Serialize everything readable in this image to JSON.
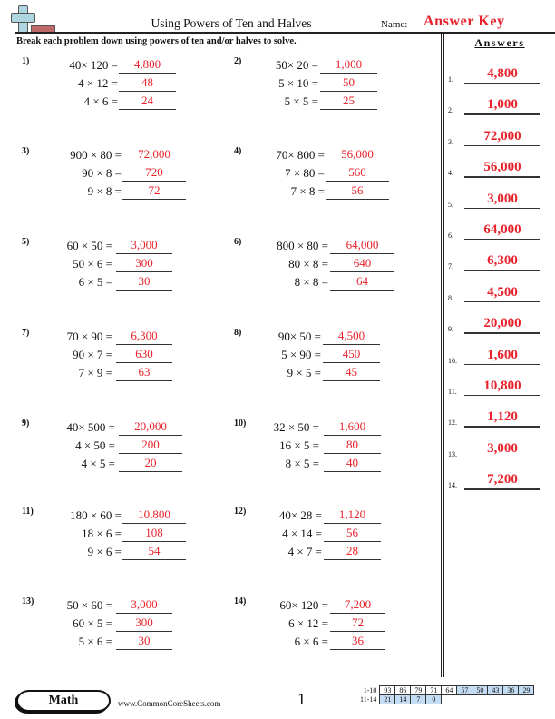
{
  "header": {
    "title": "Using Powers of Ten and Halves",
    "name_label": "Name:",
    "name_value": "Answer Key",
    "instructions": "Break each problem down using powers of ten and/or halves to solve.",
    "logo_icon": "plus-sign-with-bar-icon"
  },
  "accent_color": "#e8222b",
  "problems": [
    {
      "num": "1)",
      "rows": [
        {
          "expr": "40× 120 =",
          "ans": "4,800"
        },
        {
          "expr": "4 × 12 =",
          "ans": "48"
        },
        {
          "expr": "4 × 6 =",
          "ans": "24"
        }
      ]
    },
    {
      "num": "2)",
      "rows": [
        {
          "expr": "50× 20 =",
          "ans": "1,000"
        },
        {
          "expr": "5 × 10 =",
          "ans": "50"
        },
        {
          "expr": "5 × 5 =",
          "ans": "25"
        }
      ]
    },
    {
      "num": "3)",
      "rows": [
        {
          "expr": "900 × 80 =",
          "ans": "72,000"
        },
        {
          "expr": "90 × 8 =",
          "ans": "720"
        },
        {
          "expr": "9 × 8 =",
          "ans": "72"
        }
      ]
    },
    {
      "num": "4)",
      "rows": [
        {
          "expr": "70× 800 =",
          "ans": "56,000"
        },
        {
          "expr": "7 × 80 =",
          "ans": "560"
        },
        {
          "expr": "7 × 8 =",
          "ans": "56"
        }
      ]
    },
    {
      "num": "5)",
      "rows": [
        {
          "expr": "60 × 50 =",
          "ans": "3,000"
        },
        {
          "expr": "50 × 6 =",
          "ans": "300"
        },
        {
          "expr": "6 × 5 =",
          "ans": "30"
        }
      ]
    },
    {
      "num": "6)",
      "rows": [
        {
          "expr": "800 × 80 =",
          "ans": "64,000"
        },
        {
          "expr": "80 × 8 =",
          "ans": "640"
        },
        {
          "expr": "8 × 8 =",
          "ans": "64"
        }
      ]
    },
    {
      "num": "7)",
      "rows": [
        {
          "expr": "70 × 90 =",
          "ans": "6,300"
        },
        {
          "expr": "90 × 7 =",
          "ans": "630"
        },
        {
          "expr": "7 × 9 =",
          "ans": "63"
        }
      ]
    },
    {
      "num": "8)",
      "rows": [
        {
          "expr": "90× 50 =",
          "ans": "4,500"
        },
        {
          "expr": "5 × 90 =",
          "ans": "450"
        },
        {
          "expr": "9 × 5 =",
          "ans": "45"
        }
      ]
    },
    {
      "num": "9)",
      "rows": [
        {
          "expr": "40× 500 =",
          "ans": "20,000"
        },
        {
          "expr": "4 × 50 =",
          "ans": "200"
        },
        {
          "expr": "4 × 5 =",
          "ans": "20"
        }
      ]
    },
    {
      "num": "10)",
      "rows": [
        {
          "expr": "32 × 50 =",
          "ans": "1,600"
        },
        {
          "expr": "16 × 5 =",
          "ans": "80"
        },
        {
          "expr": "8 × 5 =",
          "ans": "40"
        }
      ]
    },
    {
      "num": "11)",
      "rows": [
        {
          "expr": "180 × 60 =",
          "ans": "10,800"
        },
        {
          "expr": "18 × 6 =",
          "ans": "108"
        },
        {
          "expr": "9 × 6 =",
          "ans": "54"
        }
      ]
    },
    {
      "num": "12)",
      "rows": [
        {
          "expr": "40× 28 =",
          "ans": "1,120"
        },
        {
          "expr": "4 × 14 =",
          "ans": "56"
        },
        {
          "expr": "4 × 7 =",
          "ans": "28"
        }
      ]
    },
    {
      "num": "13)",
      "rows": [
        {
          "expr": "50 × 60 =",
          "ans": "3,000"
        },
        {
          "expr": "60 × 5 =",
          "ans": "300"
        },
        {
          "expr": "5 × 6 =",
          "ans": "30"
        }
      ]
    },
    {
      "num": "14)",
      "rows": [
        {
          "expr": "60× 120 =",
          "ans": "7,200"
        },
        {
          "expr": "6 × 12 =",
          "ans": "72"
        },
        {
          "expr": "6 × 6 =",
          "ans": "36"
        }
      ]
    }
  ],
  "answer_key": {
    "heading": "Answers",
    "items": [
      {
        "num": "1.",
        "value": "4,800"
      },
      {
        "num": "2.",
        "value": "1,000"
      },
      {
        "num": "3.",
        "value": "72,000"
      },
      {
        "num": "4.",
        "value": "56,000"
      },
      {
        "num": "5.",
        "value": "3,000"
      },
      {
        "num": "6.",
        "value": "64,000"
      },
      {
        "num": "7.",
        "value": "6,300"
      },
      {
        "num": "8.",
        "value": "4,500"
      },
      {
        "num": "9.",
        "value": "20,000"
      },
      {
        "num": "10.",
        "value": "1,600"
      },
      {
        "num": "11.",
        "value": "10,800"
      },
      {
        "num": "12.",
        "value": "1,120"
      },
      {
        "num": "13.",
        "value": "3,000"
      },
      {
        "num": "14.",
        "value": "7,200"
      }
    ]
  },
  "footer": {
    "subject": "Math",
    "website": "www.CommonCoreSheets.com",
    "page_number": "1",
    "score_table": {
      "rows": [
        {
          "label": "1-10",
          "cells": [
            "93",
            "86",
            "79",
            "71",
            "64",
            "57",
            "50",
            "43",
            "36",
            "29"
          ],
          "highlighted_from": 5
        },
        {
          "label": "11-14",
          "cells": [
            "21",
            "14",
            "7",
            "0"
          ],
          "highlighted_from": 0
        }
      ]
    }
  }
}
